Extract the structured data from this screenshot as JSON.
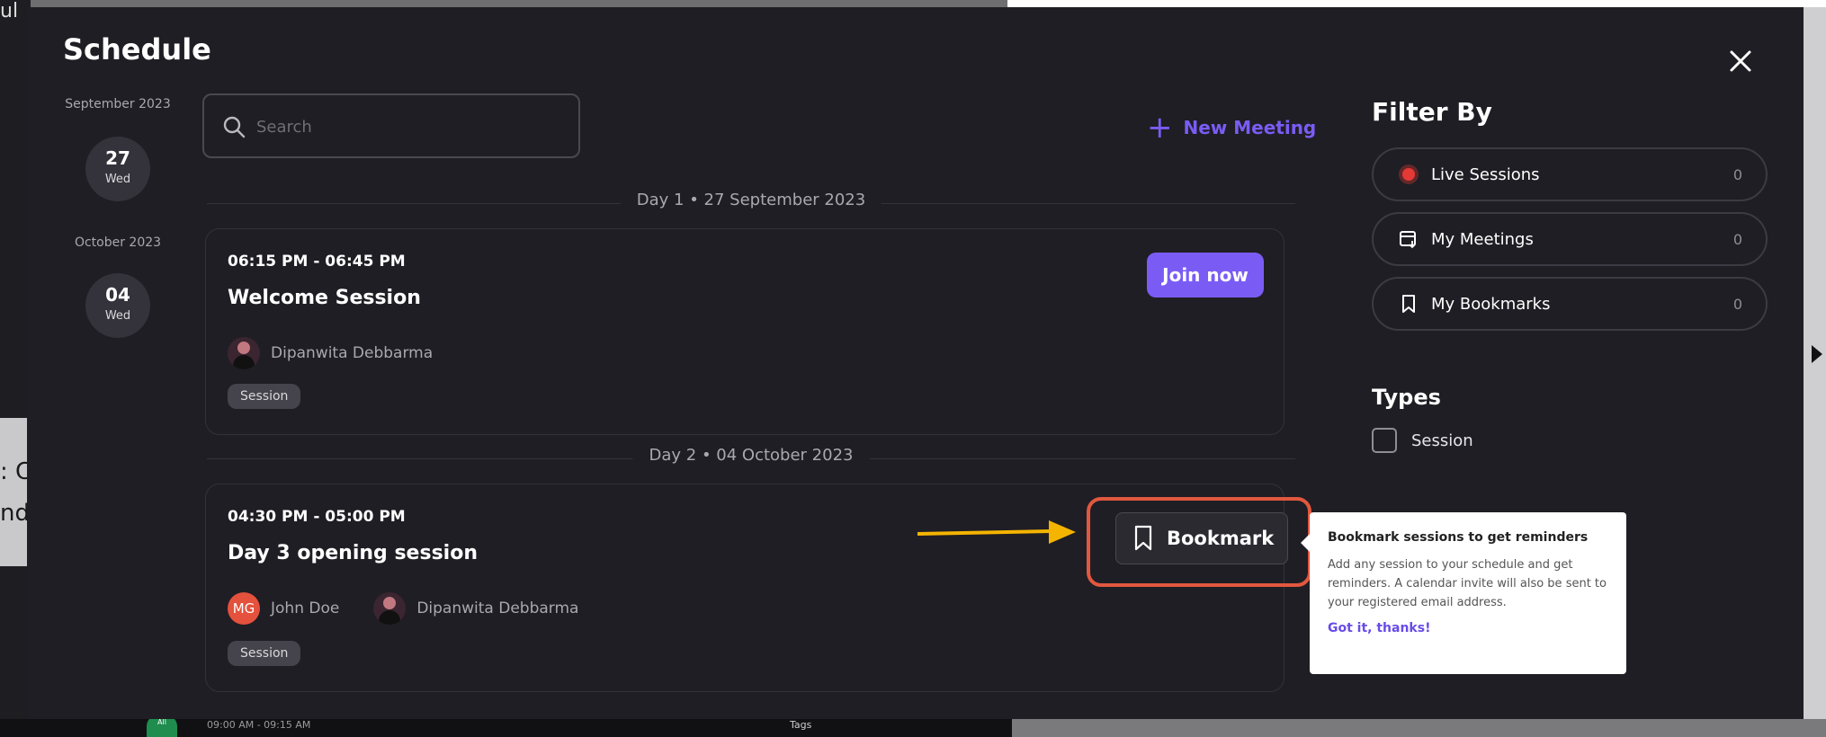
{
  "background": {
    "left_fragment": "ul",
    "left_fragment_2": ": C",
    "left_fragment_3": "nd",
    "footer_avatar": "All",
    "footer_time": "09:00 AM - 09:15 AM",
    "footer_tags": "Tags"
  },
  "modal": {
    "title": "Schedule",
    "close_icon": "close-icon"
  },
  "date_nav": [
    {
      "month": "September 2023",
      "day": "27",
      "weekday": "Wed"
    },
    {
      "month": "October 2023",
      "day": "04",
      "weekday": "Wed"
    }
  ],
  "search": {
    "placeholder": "Search",
    "value": ""
  },
  "new_meeting": {
    "label": "New Meeting"
  },
  "days": [
    {
      "label": "Day 1 • 27 September 2023",
      "sessions": [
        {
          "time": "06:15 PM - 06:45 PM",
          "title": "Welcome Session",
          "speakers": [
            {
              "name": "Dipanwita Debbarma",
              "initials": ""
            }
          ],
          "tag": "Session",
          "action": "Join now"
        }
      ]
    },
    {
      "label": "Day 2 • 04 October 2023",
      "sessions": [
        {
          "time": "04:30 PM - 05:00 PM",
          "title": "Day 3 opening session",
          "speakers": [
            {
              "name": "John Doe",
              "initials": "MG"
            },
            {
              "name": "Dipanwita Debbarma",
              "initials": ""
            }
          ],
          "tag": "Session",
          "action": "Bookmark"
        }
      ]
    }
  ],
  "filter": {
    "title": "Filter By",
    "items": [
      {
        "label": "Live Sessions",
        "count": "0",
        "icon": "live-dot-icon"
      },
      {
        "label": "My Meetings",
        "count": "0",
        "icon": "calendar-icon"
      },
      {
        "label": "My Bookmarks",
        "count": "0",
        "icon": "bookmark-icon"
      }
    ],
    "types_title": "Types",
    "types": [
      {
        "label": "Session",
        "checked": false
      }
    ]
  },
  "tooltip": {
    "title": "Bookmark sessions to get reminders",
    "body": "Add any session to your schedule and get reminders. A calendar invite will also be sent to your registered email address.",
    "link": "Got it, thanks!"
  },
  "colors": {
    "accent": "#7a5cf5",
    "highlight": "#e2583f",
    "arrow": "#f4b400",
    "live": "#e53935",
    "modal_bg": "#1f1e24"
  }
}
